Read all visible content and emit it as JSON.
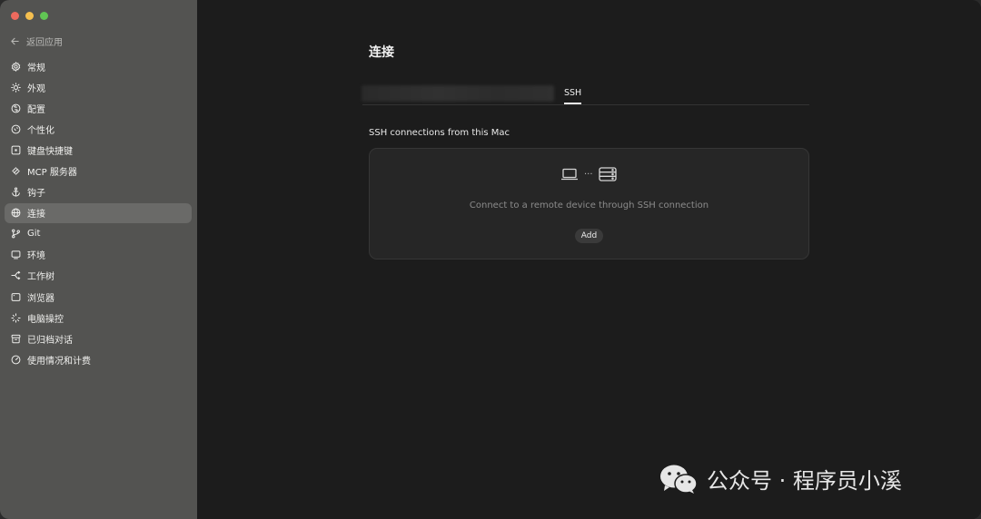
{
  "sidebar": {
    "back_label": "返回应用",
    "items": [
      {
        "label": "常规",
        "icon": "gear-icon"
      },
      {
        "label": "外观",
        "icon": "sun-icon"
      },
      {
        "label": "配置",
        "icon": "config-icon"
      },
      {
        "label": "个性化",
        "icon": "personalize-icon"
      },
      {
        "label": "键盘快捷键",
        "icon": "keyboard-icon"
      },
      {
        "label": "MCP 服务器",
        "icon": "mcp-icon"
      },
      {
        "label": "钩子",
        "icon": "anchor-icon"
      },
      {
        "label": "连接",
        "icon": "globe-icon",
        "active": true
      },
      {
        "label": "Git",
        "icon": "git-branch-icon"
      },
      {
        "label": "环境",
        "icon": "monitor-icon"
      },
      {
        "label": "工作树",
        "icon": "worktree-icon"
      },
      {
        "label": "浏览器",
        "icon": "browser-icon"
      },
      {
        "label": "电脑操控",
        "icon": "sparkle-icon"
      },
      {
        "label": "已归档对话",
        "icon": "archive-icon"
      },
      {
        "label": "使用情况和计费",
        "icon": "gauge-icon"
      }
    ]
  },
  "main": {
    "title": "连接",
    "tabs": [
      {
        "label": "",
        "blurred": true
      },
      {
        "label": "SSH",
        "active": true
      }
    ],
    "section_title": "SSH connections from this Mac",
    "card": {
      "dots": "···",
      "description": "Connect to a remote device through SSH connection",
      "add_label": "Add"
    }
  },
  "watermark": {
    "text": "公众号 · 程序员小溪",
    "icon": "wechat-icon"
  },
  "colors": {
    "sidebar_bg": "#535351",
    "main_bg": "#1c1c1c",
    "active_item": "#6a6a68",
    "card_bg": "#262626"
  }
}
